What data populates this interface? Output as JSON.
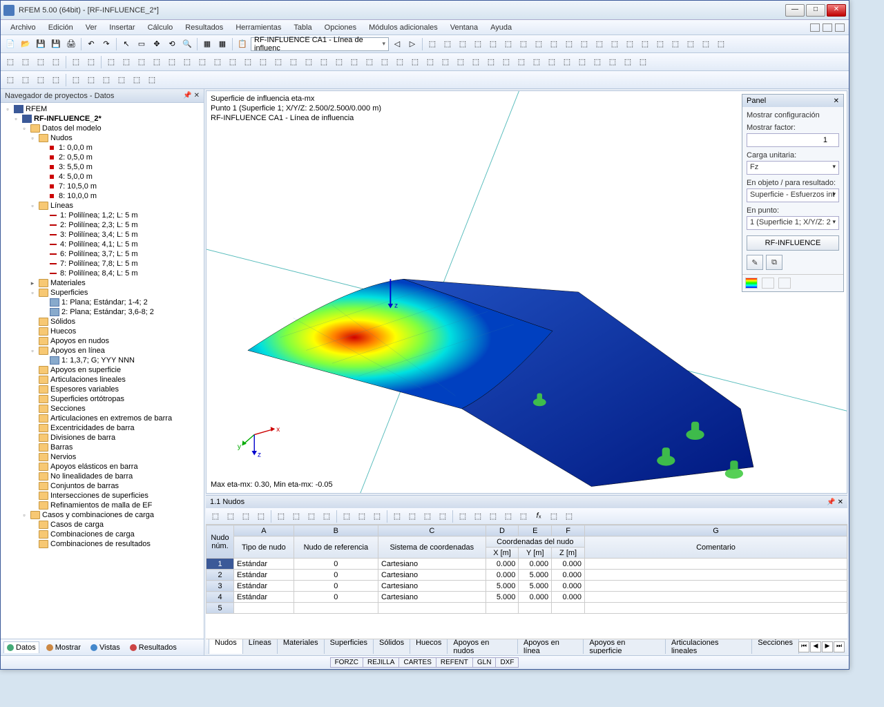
{
  "window": {
    "title": "RFEM 5.00 (64bit) - [RF-INFLUENCE_2*]"
  },
  "menu": [
    "Archivo",
    "Edición",
    "Ver",
    "Insertar",
    "Cálculo",
    "Resultados",
    "Herramientas",
    "Tabla",
    "Opciones",
    "Módulos adicionales",
    "Ventana",
    "Ayuda"
  ],
  "toolbar_combo": "RF-INFLUENCE CA1 - Línea de influenc",
  "nav": {
    "title": "Navegador de proyectos - Datos",
    "root": "RFEM",
    "model": "RF-INFLUENCE_2*",
    "model_data": "Datos del modelo",
    "nudos_label": "Nudos",
    "nudos": [
      "1: 0,0,0 m",
      "2: 0,5,0 m",
      "3: 5,5,0 m",
      "4: 5,0,0 m",
      "7: 10,5,0 m",
      "8: 10,0,0 m"
    ],
    "lineas_label": "Líneas",
    "lineas": [
      "1: Polilínea; 1,2; L: 5 m",
      "2: Polilínea; 2,3; L: 5 m",
      "3: Polilínea; 3,4; L: 5 m",
      "4: Polilínea; 4,1; L: 5 m",
      "6: Polilínea; 3,7; L: 5 m",
      "7: Polilínea; 7,8; L: 5 m",
      "8: Polilínea; 8,4; L: 5 m"
    ],
    "materiales": "Materiales",
    "superficies_label": "Superficies",
    "superficies": [
      "1: Plana; Estándar; 1-4; 2",
      "2: Plana; Estándar; 3,6-8; 2"
    ],
    "otros": [
      "Sólidos",
      "Huecos",
      "Apoyos en nudos"
    ],
    "apoyos_linea_label": "Apoyos en línea",
    "apoyos_linea": [
      "1: 1,3,7; G; YYY NNN"
    ],
    "resto": [
      "Apoyos en superficie",
      "Articulaciones lineales",
      "Espesores variables",
      "Superficies ortótropas",
      "Secciones",
      "Articulaciones en extremos de barra",
      "Excentricidades de barra",
      "Divisiones de barra",
      "Barras",
      "Nervios",
      "Apoyos elásticos en barra",
      "No linealidades de barra",
      "Conjuntos de barras",
      "Intersecciones de superficies",
      "Refinamientos de malla de EF"
    ],
    "casos_label": "Casos y combinaciones de carga",
    "casos": [
      "Casos de carga",
      "Combinaciones de carga",
      "Combinaciones de resultados"
    ],
    "tabs": [
      "Datos",
      "Mostrar",
      "Vistas",
      "Resultados"
    ]
  },
  "view": {
    "line1": "Superficie de influencia eta-mx",
    "line2": "Punto 1 (Superficie 1; X/Y/Z: 2.500/2.500/0.000 m)",
    "line3": "RF-INFLUENCE CA1 - Línea de influencia",
    "minmax": "Max eta-mx: 0.30, Min eta-mx: -0.05"
  },
  "panel": {
    "title": "Panel",
    "show_config": "Mostrar configuración",
    "factor_label": "Mostrar factor:",
    "factor_value": "1",
    "carga_label": "Carga unitaria:",
    "carga_value": "Fz",
    "obj_label": "En objeto / para resultado:",
    "obj_value": "Superficie - Esfuerzos int",
    "punto_label": "En punto:",
    "punto_value": "1 (Superficie 1; X/Y/Z: 2",
    "button": "RF-INFLUENCE"
  },
  "grid": {
    "title": "1.1 Nudos",
    "cols_letters": [
      "A",
      "B",
      "C",
      "D",
      "E",
      "F",
      "G"
    ],
    "h_nudo": "Nudo núm.",
    "h_tipo": "Tipo de nudo",
    "h_ref": "Nudo de referencia",
    "h_sis": "Sistema de coordenadas",
    "h_coord": "Coordenadas del nudo",
    "h_x": "X [m]",
    "h_y": "Y [m]",
    "h_z": "Z [m]",
    "h_com": "Comentario",
    "rows": [
      {
        "n": "1",
        "tipo": "Estándar",
        "ref": "0",
        "sis": "Cartesiano",
        "x": "0.000",
        "y": "0.000",
        "z": "0.000"
      },
      {
        "n": "2",
        "tipo": "Estándar",
        "ref": "0",
        "sis": "Cartesiano",
        "x": "0.000",
        "y": "5.000",
        "z": "0.000"
      },
      {
        "n": "3",
        "tipo": "Estándar",
        "ref": "0",
        "sis": "Cartesiano",
        "x": "5.000",
        "y": "5.000",
        "z": "0.000"
      },
      {
        "n": "4",
        "tipo": "Estándar",
        "ref": "0",
        "sis": "Cartesiano",
        "x": "5.000",
        "y": "0.000",
        "z": "0.000"
      }
    ],
    "tabs": [
      "Nudos",
      "Líneas",
      "Materiales",
      "Superficies",
      "Sólidos",
      "Huecos",
      "Apoyos en nudos",
      "Apoyos en línea",
      "Apoyos en superficie",
      "Articulaciones lineales",
      "Secciones"
    ]
  },
  "status": [
    "FORZC",
    "REJILLA",
    "CARTES",
    "REFENT",
    "GLN",
    "DXF"
  ]
}
